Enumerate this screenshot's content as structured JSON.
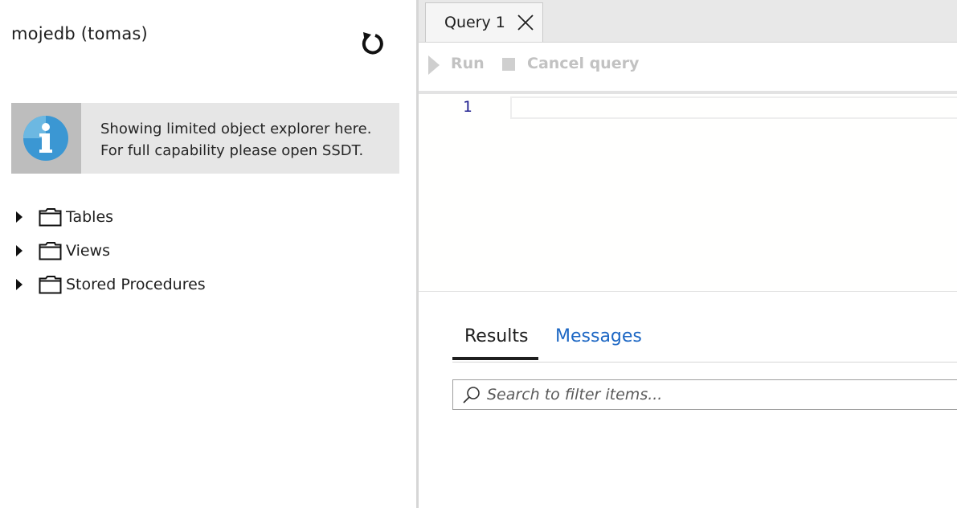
{
  "explorer": {
    "title": "mojedb (tomas)",
    "refresh_icon": "refresh-icon",
    "info": {
      "icon": "info-icon",
      "line1": "Showing limited object explorer here.",
      "line2": "For full capability please open SSDT."
    },
    "tree": [
      {
        "label": "Tables",
        "icon": "folder-icon"
      },
      {
        "label": "Views",
        "icon": "folder-icon"
      },
      {
        "label": "Stored Procedures",
        "icon": "folder-icon"
      }
    ]
  },
  "editor": {
    "tab_label": "Query 1",
    "toolbar": {
      "run_label": "Run",
      "cancel_label": "Cancel query"
    },
    "line_number": "1"
  },
  "results": {
    "tabs": [
      "Results",
      "Messages"
    ],
    "active_tab": "Results",
    "search_placeholder": "Search to filter items..."
  },
  "colors": {
    "link_blue": "#1d67c4",
    "disabled_gray": "#c2c2c2",
    "info_panel": "#e6e6e6"
  }
}
